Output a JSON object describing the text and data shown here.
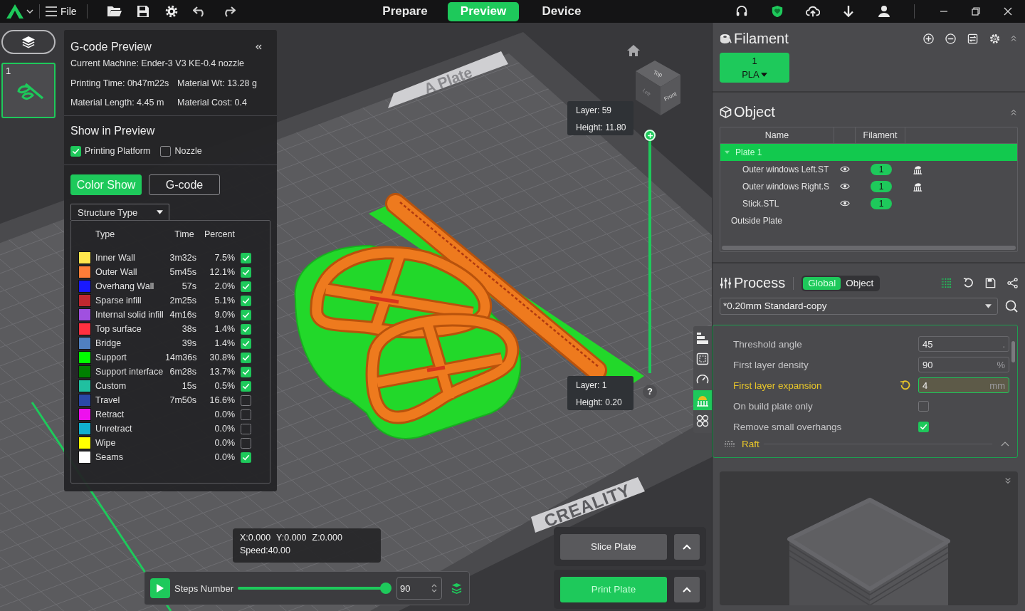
{
  "top_bar": {
    "menu": "File",
    "tabs": [
      {
        "label": "Prepare",
        "selected": false
      },
      {
        "label": "Preview",
        "selected": true
      },
      {
        "label": "Device",
        "selected": false
      }
    ]
  },
  "plate_list": {
    "expanded": true,
    "plates": [
      {
        "number": "1",
        "selected": true
      }
    ]
  },
  "gcode_preview": {
    "title": "G-code Preview",
    "machine": "Current Machine: Ender-3 V3 KE-0.4 nozzle",
    "stats": [
      "Printing Time: 0h47m22s",
      "Material Wt: 13.28 g",
      "Material Length: 4.45 m",
      "Material Cost: 0.4"
    ],
    "show_title": "Show in Preview",
    "show_options": [
      {
        "label": "Printing Platform",
        "checked": true
      },
      {
        "label": "Nozzle",
        "checked": false
      }
    ],
    "modes": [
      {
        "label": "Color Show",
        "selected": true
      },
      {
        "label": "G-code",
        "selected": false
      }
    ],
    "view_type": "Structure Type",
    "legend_columns": [
      "Type",
      "Time",
      "Percent"
    ],
    "legend": [
      {
        "type": "Inner Wall",
        "color": "#ffe64d",
        "time": "3m32s",
        "percent": "7.5%",
        "checked": true
      },
      {
        "type": "Outer Wall",
        "color": "#ff7d38",
        "time": "5m45s",
        "percent": "12.1%",
        "checked": true
      },
      {
        "type": "Overhang Wall",
        "color": "#1919ff",
        "time": "57s",
        "percent": "2.0%",
        "checked": true
      },
      {
        "type": "Sparse infill",
        "color": "#c02830",
        "time": "2m25s",
        "percent": "5.1%",
        "checked": true
      },
      {
        "type": "Internal solid infill",
        "color": "#a050e0",
        "time": "4m16s",
        "percent": "9.0%",
        "checked": true
      },
      {
        "type": "Top surface",
        "color": "#ff3040",
        "time": "38s",
        "percent": "1.4%",
        "checked": true
      },
      {
        "type": "Bridge",
        "color": "#5080c0",
        "time": "39s",
        "percent": "1.4%",
        "checked": true
      },
      {
        "type": "Support",
        "color": "#00ff00",
        "time": "14m36s",
        "percent": "30.8%",
        "checked": true
      },
      {
        "type": "Support interface",
        "color": "#008000",
        "time": "6m28s",
        "percent": "13.7%",
        "checked": true
      },
      {
        "type": "Custom",
        "color": "#20c0a0",
        "time": "15s",
        "percent": "0.5%",
        "checked": true
      },
      {
        "type": "Travel",
        "color": "#2a48a8",
        "time": "7m50s",
        "percent": "16.6%",
        "checked": false
      },
      {
        "type": "Retract",
        "color": "#ee10ee",
        "percent": "0.0%",
        "checked": false
      },
      {
        "type": "Unretract",
        "color": "#10b0d0",
        "percent": "0.0%",
        "checked": false
      },
      {
        "type": "Wipe",
        "color": "#ffff00",
        "percent": "0.0%",
        "checked": false
      },
      {
        "type": "Seams",
        "color": "#ffffff",
        "percent": "0.0%",
        "checked": true
      }
    ]
  },
  "viewport": {
    "plate_labels": [
      "A Plate",
      "CREALITY"
    ],
    "cube_faces": [
      "Top",
      "Left",
      "Front"
    ],
    "layer_slider": {
      "level": 1,
      "top_layer": "Layer: 59",
      "top_height": "Height: 11.80",
      "bottom_layer": "Layer: 1",
      "bottom_height": "Height: 0.20"
    },
    "help": "?",
    "tools": [
      {
        "kind": "layers",
        "selected": false
      },
      {
        "kind": "bounds",
        "selected": false
      },
      {
        "kind": "speed",
        "selected": false
      },
      {
        "kind": "support",
        "selected": true
      },
      {
        "kind": "arrange",
        "selected": false
      }
    ],
    "position": [
      "X:0.000",
      "Y:0.000",
      "Z:0.000"
    ],
    "speed": "Speed:40.00",
    "steps": {
      "label": "Steps Number",
      "level": 1,
      "value": "90"
    },
    "actions": [
      {
        "label": "Slice Plate",
        "kind": "secondary"
      },
      {
        "label": "Print Plate",
        "kind": "primary"
      }
    ]
  },
  "filament": {
    "title": "Filament",
    "slots": [
      {
        "number": "1",
        "material": "PLA"
      }
    ]
  },
  "objects": {
    "title": "Object",
    "columns": [
      "Name",
      "Filament"
    ],
    "items": [
      {
        "name": "Plate 1",
        "selected": true,
        "expanded": true,
        "children": [
          {
            "name": "Outer windows Left.ST",
            "filament": "1",
            "support": true,
            "selected": false
          },
          {
            "name": "Outer windows Right.S",
            "filament": "1",
            "support": true,
            "selected": false
          },
          {
            "name": "Stick.STL",
            "filament": "1",
            "support": false,
            "selected": false
          }
        ]
      },
      {
        "name": "Outside Plate",
        "selected": false
      }
    ]
  },
  "process": {
    "title": "Process",
    "scopes": [
      {
        "label": "Global",
        "selected": true
      },
      {
        "label": "Object",
        "selected": false
      }
    ],
    "preset": "*0.20mm Standard-copy",
    "settings": [
      {
        "kind": "number",
        "label": "Threshold angle",
        "value": "45",
        "unit": ".",
        "modified": false
      },
      {
        "kind": "number",
        "label": "First layer density",
        "value": "90",
        "unit": "%",
        "modified": false
      },
      {
        "kind": "number",
        "label": "First layer expansion",
        "value": "4",
        "unit": "mm",
        "modified": true
      },
      {
        "kind": "checkbox",
        "label": "On build plate only",
        "checked": false,
        "modified": false
      },
      {
        "kind": "checkbox",
        "label": "Remove small overhangs",
        "checked": true,
        "modified": false
      }
    ],
    "section": "Raft"
  }
}
